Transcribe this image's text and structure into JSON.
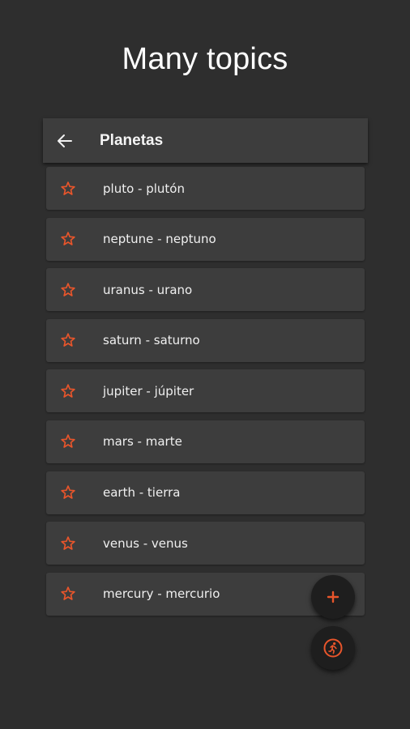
{
  "header": {
    "title": "Many topics"
  },
  "appbar": {
    "title": "Planetas",
    "back_icon": "arrow-left-icon"
  },
  "colors": {
    "accent": "#e8552b",
    "background": "#2e2e2e",
    "card": "#3d3d3d"
  },
  "items": [
    {
      "label": "pluto - plutón"
    },
    {
      "label": "neptune - neptuno"
    },
    {
      "label": "uranus - urano"
    },
    {
      "label": "saturn - saturno"
    },
    {
      "label": "jupiter - júpiter"
    },
    {
      "label": "mars - marte"
    },
    {
      "label": "earth - tierra"
    },
    {
      "label": "venus - venus"
    },
    {
      "label": "mercury - mercurio"
    }
  ],
  "fabs": {
    "add_icon": "plus-icon",
    "run_icon": "running-person-icon"
  }
}
